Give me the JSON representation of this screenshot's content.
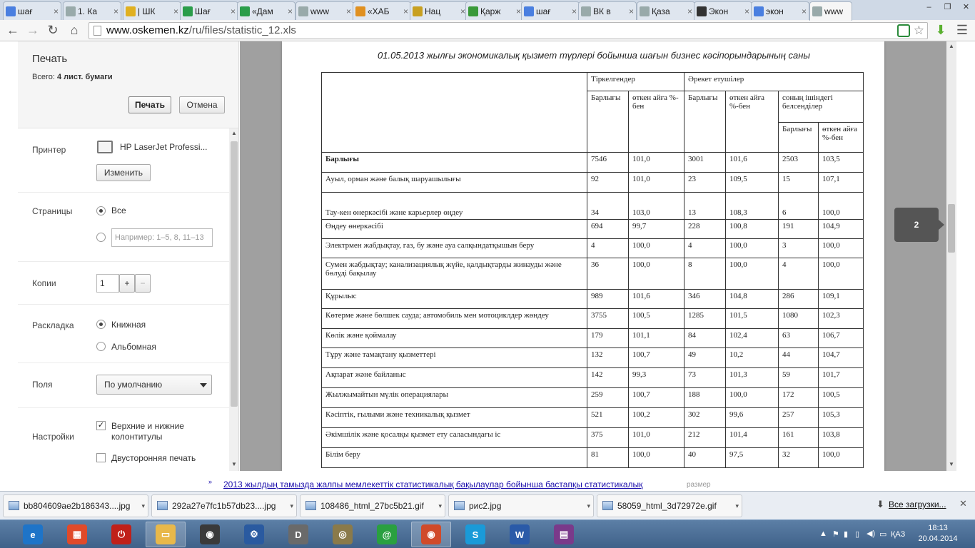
{
  "tabs": [
    {
      "label": "шағ",
      "favicon": "google-icon",
      "color": "#4a7fe0",
      "active": false
    },
    {
      "label": "1. Ка",
      "favicon": "page-icon",
      "color": "#9aa",
      "active": false
    },
    {
      "label": "| ШК",
      "favicon": "flag-icon",
      "color": "#e0b020",
      "active": false
    },
    {
      "label": "Шағ",
      "favicon": "globe-icon",
      "color": "#2a9d4a",
      "active": false
    },
    {
      "label": "«Дам",
      "favicon": "globe-icon",
      "color": "#2a9d4a",
      "active": false
    },
    {
      "label": "www",
      "favicon": "page-icon",
      "color": "#9aa",
      "active": false
    },
    {
      "label": "«ХАБ",
      "favicon": "fish-icon",
      "color": "#e09020",
      "active": false
    },
    {
      "label": "Нац",
      "favicon": "emblem-icon",
      "color": "#c8a020",
      "active": false
    },
    {
      "label": "Қарж",
      "favicon": "egov-icon",
      "color": "#3a9a3a",
      "active": false
    },
    {
      "label": "шағ",
      "favicon": "google-icon",
      "color": "#4a7fe0",
      "active": false
    },
    {
      "label": "ВК в",
      "favicon": "page-icon",
      "color": "#9aa",
      "active": false
    },
    {
      "label": "Қаза",
      "favicon": "page-icon",
      "color": "#9aa",
      "active": false
    },
    {
      "label": "Экон",
      "favicon": "e-icon",
      "color": "#333",
      "active": false
    },
    {
      "label": "экон",
      "favicon": "google-icon",
      "color": "#4a7fe0",
      "active": false
    },
    {
      "label": "www",
      "favicon": "page-icon",
      "color": "#9aa",
      "active": true
    }
  ],
  "toolbar": {
    "url_host": "www.oskemen.kz",
    "url_path": "/ru/files/statistic_12.xls"
  },
  "print": {
    "title": "Печать",
    "total_label": "Всего:",
    "total_value": "4 лист. бумаги",
    "print_button": "Печать",
    "cancel_button": "Отмена",
    "printer_label": "Принтер",
    "printer_name": "HP LaserJet Professi...",
    "change_button": "Изменить",
    "pages_label": "Страницы",
    "pages_all": "Все",
    "pages_placeholder": "Например: 1–5, 8, 11–13",
    "copies_label": "Копии",
    "copies_value": "1",
    "copies_plus": "+",
    "copies_minus": "−",
    "layout_label": "Раскладка",
    "layout_portrait": "Книжная",
    "layout_landscape": "Альбомная",
    "margins_label": "Поля",
    "margins_value": "По умолчанию",
    "settings_label": "Настройки",
    "headers_footers": "Верхние и нижние колонтитулы",
    "duplex": "Двусторонняя печать"
  },
  "preview": {
    "page_number": "2",
    "title": "01.05.2013 жылғы экономикалық қызмет түрлері бойынша шағын бизнес кәсіпорындарының саны",
    "headers": {
      "registered": "Тіркелгендер",
      "operating": "Әрекет етушілер",
      "total": "Барлығы",
      "pct_prev": "өткен айға %-бен",
      "active_of_which": "соның ішіндегі белсенділер"
    },
    "rows": [
      {
        "name": "Барлығы",
        "bold": true,
        "v": [
          "7546",
          "101,0",
          "3001",
          "101,6",
          "2503",
          "103,5"
        ]
      },
      {
        "name": "Ауыл, орман және балық шаруашылығы",
        "v": [
          "92",
          "101,0",
          "23",
          "109,5",
          "15",
          "107,1"
        ]
      },
      {
        "name": "Тау-кен өнеркәсібі және карьерлер өңдеу",
        "v": [
          "34",
          "103,0",
          "13",
          "108,3",
          "6",
          "100,0"
        ]
      },
      {
        "name": "Өңдеу өнеркәсібі",
        "v": [
          "694",
          "99,7",
          "228",
          "100,8",
          "191",
          "104,9"
        ]
      },
      {
        "name": "Электрмен жабдықтау, газ, бу және ауа салқындатқышын беру",
        "v": [
          "4",
          "100,0",
          "4",
          "100,0",
          "3",
          "100,0"
        ]
      },
      {
        "name": "Сумен жабдықтау; канализациялық жүйе, қалдықтарды жинауды және бөлуді бақылау",
        "v": [
          "36",
          "100,0",
          "8",
          "100,0",
          "4",
          "100,0"
        ]
      },
      {
        "name": "Құрылыс",
        "v": [
          "989",
          "101,6",
          "346",
          "104,8",
          "286",
          "109,1"
        ]
      },
      {
        "name": "Көтерме және бөлшек сауда; автомобиль мен мотоциклдер жөндеу",
        "v": [
          "3755",
          "100,5",
          "1285",
          "101,5",
          "1080",
          "102,3"
        ]
      },
      {
        "name": "Көлік және қоймалау",
        "v": [
          "179",
          "101,1",
          "84",
          "102,4",
          "63",
          "106,7"
        ]
      },
      {
        "name": "Тұру және тамақтану қызметтері",
        "v": [
          "132",
          "100,7",
          "49",
          "10,2",
          "44",
          "104,7"
        ]
      },
      {
        "name": "Ақпарат және байланыс",
        "v": [
          "142",
          "99,3",
          "73",
          "101,3",
          "59",
          "101,7"
        ]
      },
      {
        "name": "Жылжымайтын мүлік операциялары",
        "v": [
          "259",
          "100,7",
          "188",
          "100,0",
          "172",
          "100,5"
        ]
      },
      {
        "name": "Кәсіптік, ғылыми және техникалық қызмет",
        "v": [
          "521",
          "100,2",
          "302",
          "99,6",
          "257",
          "105,3"
        ]
      },
      {
        "name": "Әкімшілік және қосалқы қызмет ету саласындағы іс",
        "v": [
          "375",
          "101,0",
          "212",
          "101,4",
          "161",
          "103,8"
        ]
      },
      {
        "name": "Білім беру",
        "v": [
          "81",
          "100,0",
          "40",
          "97,5",
          "32",
          "100,0"
        ]
      }
    ]
  },
  "underpage": {
    "link": "2013 жылдың тамызда жалпы мемлекеттік статистикалық бақылаулар бойынша бастапқы статистикалық",
    "razmer": "размер"
  },
  "downloads": [
    {
      "name": "bb804609ae2b186343....jpg"
    },
    {
      "name": "292a27e7fc1b57db23....jpg"
    },
    {
      "name": "108486_html_27bc5b21.gif"
    },
    {
      "name": "рис2.jpg"
    },
    {
      "name": "58059_html_3d72972e.gif"
    }
  ],
  "all_downloads": "Все загрузки...",
  "taskbar": {
    "apps": [
      {
        "name": "ie-icon",
        "color": "#1e74c8",
        "glyph": "e",
        "active": false
      },
      {
        "name": "apps-icon",
        "color": "#e04a2a",
        "glyph": "▦",
        "active": false
      },
      {
        "name": "power-icon",
        "color": "#c0201a",
        "glyph": "⏻",
        "active": false
      },
      {
        "name": "folder-icon",
        "color": "#e8b84a",
        "glyph": "▭",
        "active": true
      },
      {
        "name": "speaker-icon",
        "color": "#3a3a3a",
        "glyph": "◉",
        "active": false
      },
      {
        "name": "settings-icon",
        "color": "#2a5aa0",
        "glyph": "⚙",
        "active": false
      },
      {
        "name": "doc-icon",
        "color": "#6a6a6a",
        "glyph": "D",
        "active": false
      },
      {
        "name": "film-icon",
        "color": "#8a7a4a",
        "glyph": "◎",
        "active": false
      },
      {
        "name": "agent-icon",
        "color": "#2aa040",
        "glyph": "@",
        "active": false
      },
      {
        "name": "chrome-icon",
        "color": "#d04a2a",
        "glyph": "◉",
        "active": true
      },
      {
        "name": "skype-icon",
        "color": "#1a9ad8",
        "glyph": "S",
        "active": false
      },
      {
        "name": "word-icon",
        "color": "#2a5aa8",
        "glyph": "W",
        "active": false
      },
      {
        "name": "winrar-icon",
        "color": "#7a3a8a",
        "glyph": "▤",
        "active": false
      }
    ],
    "language": "ҚАЗ",
    "time": "18:13",
    "date": "20.04.2014"
  }
}
